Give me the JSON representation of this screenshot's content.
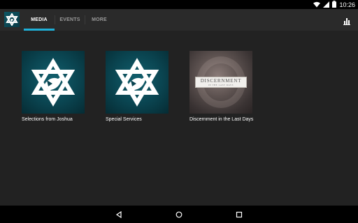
{
  "status_bar": {
    "time": "10:26",
    "icons": [
      "wifi-icon",
      "cellular-signal-icon",
      "battery-icon"
    ]
  },
  "app_bar": {
    "logo": "star-of-david-logo",
    "tabs": [
      {
        "label": "MEDIA",
        "active": true
      },
      {
        "label": "EVENTS",
        "active": false
      },
      {
        "label": "MORE",
        "active": false
      }
    ],
    "action_icon": "bar-chart-icon",
    "accent_color": "#1fb0d8"
  },
  "media": {
    "items": [
      {
        "title": "Selections from Joshua",
        "artwork": "star-of-david-dove-artwork"
      },
      {
        "title": "Special Services",
        "artwork": "star-of-david-dove-artwork"
      },
      {
        "title": "Discernment in the Last Days",
        "artwork_title": "DISCERNMENT",
        "artwork_subtitle": "IN THE LAST DAYS"
      }
    ]
  },
  "nav_bar": {
    "buttons": [
      "back-icon",
      "home-icon",
      "recents-icon"
    ]
  }
}
